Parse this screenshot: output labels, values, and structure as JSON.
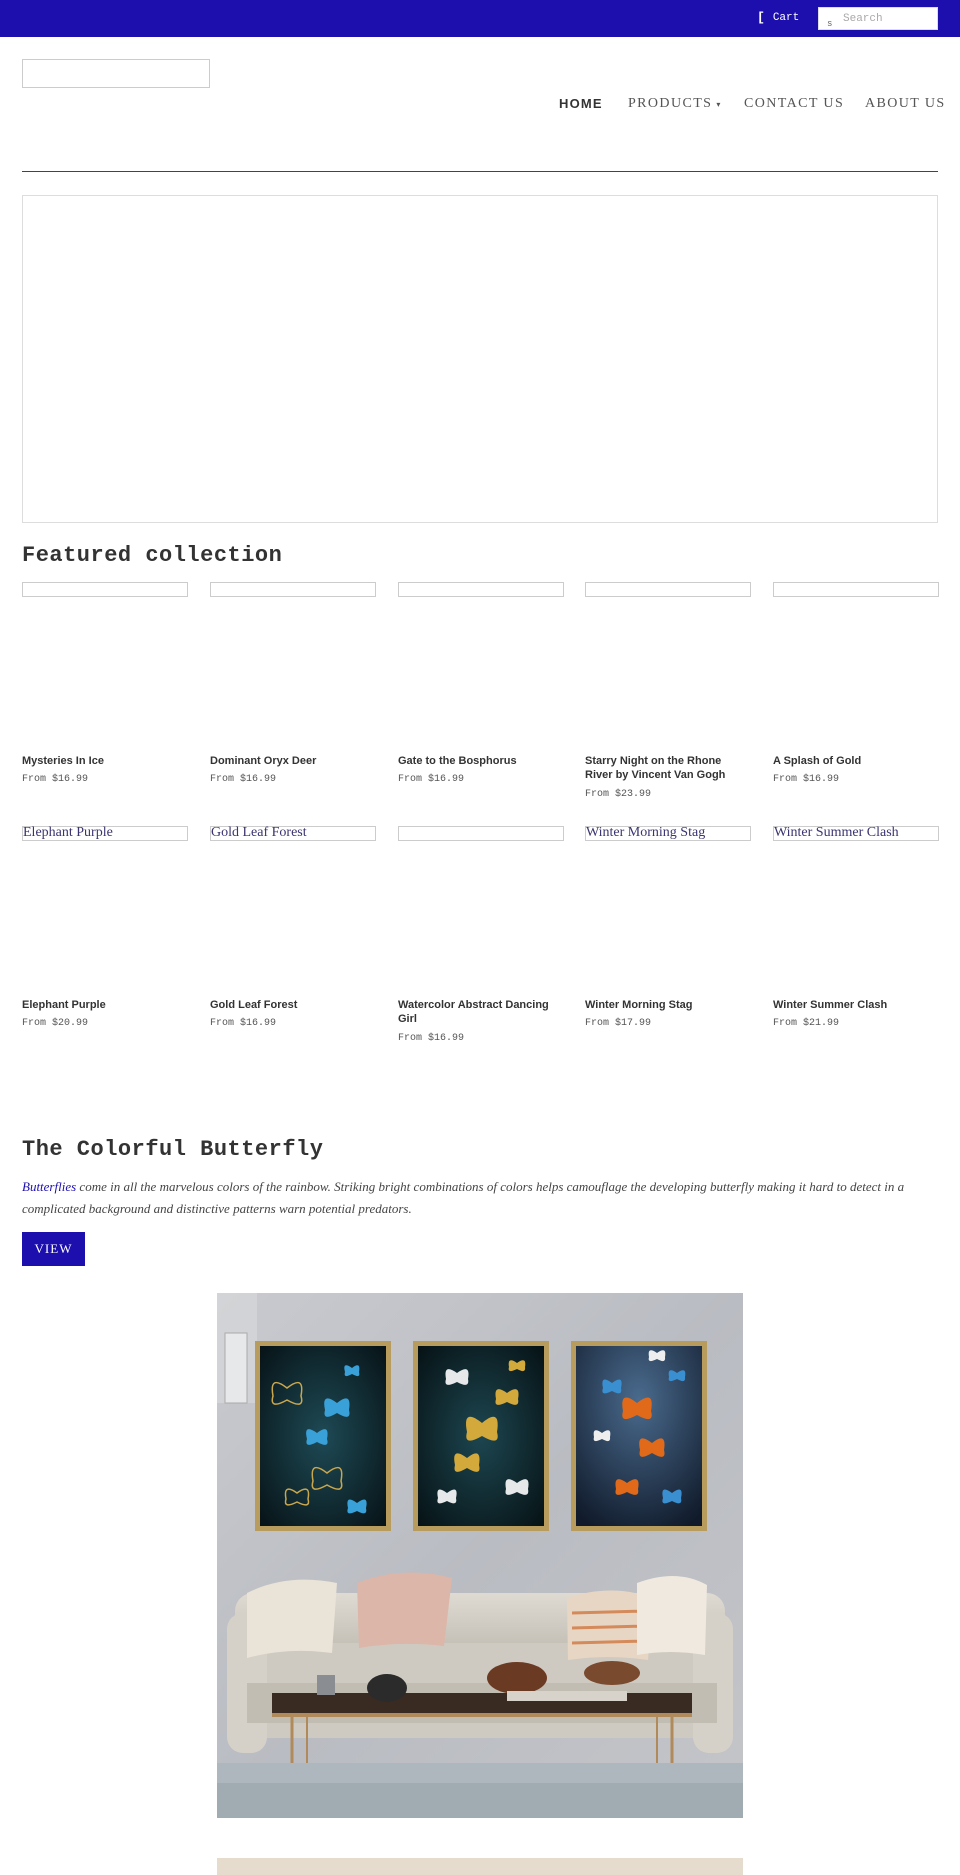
{
  "topbar": {
    "cart_label": "Cart",
    "search_placeholder": "Search",
    "accent_color": "#1c0fae"
  },
  "nav": {
    "home": "HOME",
    "products": "PRODUCTS",
    "contact": "CONTACT US",
    "about": "ABOUT US"
  },
  "featured": {
    "title": "Featured collection",
    "products": [
      {
        "name": "Mysteries In Ice",
        "price": "From $16.99",
        "alt": ""
      },
      {
        "name": "Dominant Oryx Deer",
        "price": "From $16.99",
        "alt": ""
      },
      {
        "name": "Gate to the Bosphorus",
        "price": "From $16.99",
        "alt": ""
      },
      {
        "name": "Starry Night on the Rhone River by Vincent Van Gogh",
        "price": "From $23.99",
        "alt": ""
      },
      {
        "name": "A Splash of Gold",
        "price": "From $16.99",
        "alt": ""
      },
      {
        "name": "Elephant Purple",
        "price": "From $20.99",
        "alt": "Elephant Purple"
      },
      {
        "name": "Gold Leaf Forest",
        "price": "From $16.99",
        "alt": "Gold Leaf Forest"
      },
      {
        "name": "Watercolor Abstract Dancing Girl",
        "price": "From $16.99",
        "alt": ""
      },
      {
        "name": "Winter Morning Stag",
        "price": "From $17.99",
        "alt": "Winter Morning Stag"
      },
      {
        "name": "Winter Summer Clash",
        "price": "From $21.99",
        "alt": "Winter Summer Clash"
      }
    ]
  },
  "feature": {
    "title": "The Colorful Butterfly",
    "link_text": "Butterflies",
    "description": " come in all the marvelous colors of the rainbow. Striking bright combinations of colors helps camouflage the developing butterfly making it hard to detect in a complicated background and distinctive patterns warn potential predators.",
    "button_label": "VIEW"
  }
}
